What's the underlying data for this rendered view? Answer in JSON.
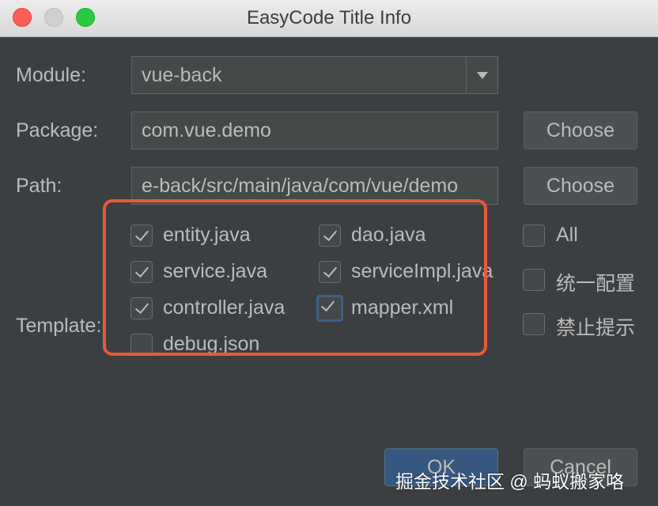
{
  "window": {
    "title": "EasyCode Title Info"
  },
  "form": {
    "module_label": "Module:",
    "module_value": "vue-back",
    "package_label": "Package:",
    "package_value": "com.vue.demo",
    "path_label": "Path:",
    "path_value": "e-back/src/main/java/com/vue/demo",
    "choose_label": "Choose",
    "template_label": "Template:"
  },
  "templates": [
    {
      "label": "entity.java",
      "checked": true
    },
    {
      "label": "dao.java",
      "checked": true
    },
    {
      "label": "service.java",
      "checked": true
    },
    {
      "label": "serviceImpl.java",
      "checked": true
    },
    {
      "label": "controller.java",
      "checked": true
    },
    {
      "label": "mapper.xml",
      "checked": true
    },
    {
      "label": "debug.json",
      "checked": false
    }
  ],
  "options": [
    {
      "label": "All",
      "checked": false
    },
    {
      "label": "统一配置",
      "checked": false
    },
    {
      "label": "禁止提示",
      "checked": false
    }
  ],
  "footer": {
    "ok_label": "OK",
    "cancel_label": "Cancel"
  },
  "watermark": "掘金技术社区 @ 蚂蚁搬家咯",
  "colors": {
    "background": "#3c3f41",
    "highlight": "#e55b37",
    "primary_button": "#365880"
  }
}
